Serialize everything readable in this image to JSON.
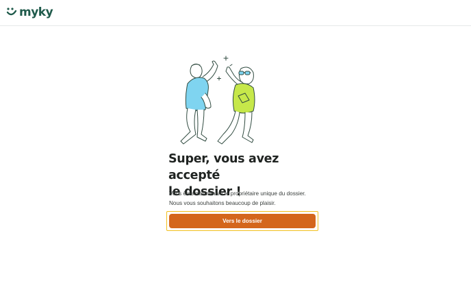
{
  "header": {
    "logo_text": "myky",
    "logo_icon": "myky-smile-logo",
    "brand_color": "#1f5a4b"
  },
  "main": {
    "illustration": "high-five-illustration",
    "title_line1": "Super, vous avez accepté",
    "title_line2": "le dossier !",
    "message_line1": "Vous êtes maintenant le propriétaire unique du dossier.",
    "message_line2": "Nous vous souhaitons beaucoup de plaisir.",
    "cta_label": "Vers le dossier",
    "cta_color": "#d4661c",
    "focus_color": "#f2bf1b",
    "accent_lime": "#c6e84a",
    "accent_blue": "#7fd4f0"
  }
}
